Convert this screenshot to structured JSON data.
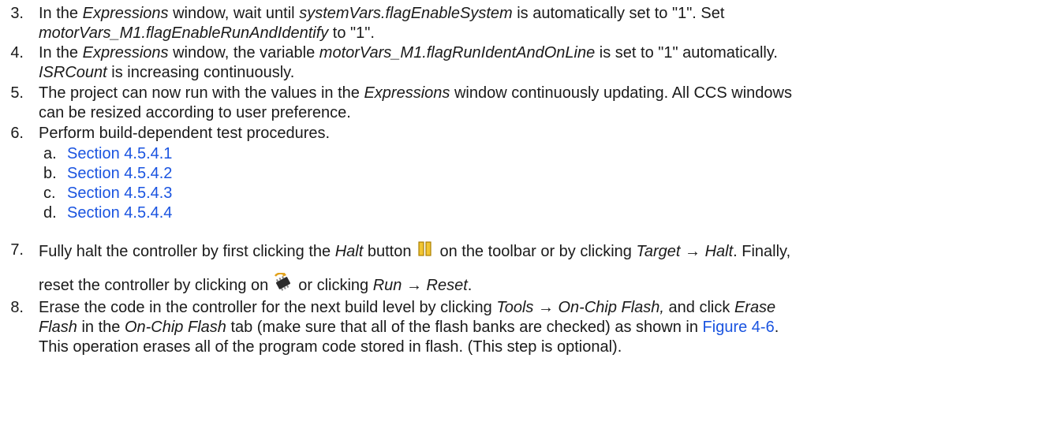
{
  "steps": [
    {
      "num": "3.",
      "l1_a": "In the ",
      "l1_b": "Expressions",
      "l1_c": " window, wait until ",
      "l1_d": "systemVars.flagEnableSystem",
      "l1_e": " is automatically set to \"1\". Set",
      "l2_a": "motorVars_M1.flagEnableRunAndIdentify",
      "l2_b": " to \"1\"."
    },
    {
      "num": "4.",
      "l1_a": "In the ",
      "l1_b": "Expressions",
      "l1_c": " window, the variable ",
      "l1_d": "motorVars_M1.flagRunIdentAndOnLine",
      "l1_e": " is set to \"1\" automatically.",
      "l2_a": "ISRCount",
      "l2_b": " is increasing continuously."
    },
    {
      "num": "5.",
      "l1_a": "The project can now run with the values in the ",
      "l1_b": "Expressions",
      "l1_c": " window continuously updating. All CCS windows",
      "l2": "can be resized according to user preference."
    },
    {
      "num": "6.",
      "l1": "Perform build-dependent test procedures.",
      "subs": [
        {
          "letter": "a.",
          "link": "Section 4.5.4.1"
        },
        {
          "letter": "b.",
          "link": "Section 4.5.4.2"
        },
        {
          "letter": "c.",
          "link": "Section 4.5.4.3"
        },
        {
          "letter": "d.",
          "link": "Section 4.5.4.4"
        }
      ]
    },
    {
      "num": "7.",
      "l1_a": "Fully halt the controller by first clicking the ",
      "l1_b": "Halt",
      "l1_c": " button",
      "l1_d": "on the toolbar or by clicking ",
      "l1_e": "Target → Halt",
      "l1_f": ". Finally,",
      "l2_a": "reset the controller by clicking on",
      "l2_b": "or clicking ",
      "l2_c": "Run → Reset",
      "l2_d": "."
    },
    {
      "num": "8.",
      "l1_a": "Erase the code in the controller for the next build level by clicking ",
      "l1_b": "Tools → On-Chip Flash,",
      "l1_c": " and click ",
      "l1_d": "Erase",
      "l2_a": "Flash",
      "l2_b": " in the ",
      "l2_c": "On-Chip Flash",
      "l2_d": " tab (make sure that all of the flash banks are checked) as shown in ",
      "l2_e": "Figure 4-6",
      "l2_f": ".",
      "l3": "This operation erases all of the program code stored in flash. (This step is optional)."
    }
  ],
  "icons": {
    "halt": "halt-icon",
    "reset": "reset-icon"
  },
  "colors": {
    "link": "#1a54e0",
    "text": "#1a1a1a",
    "halt_icon": "#d9a400"
  }
}
